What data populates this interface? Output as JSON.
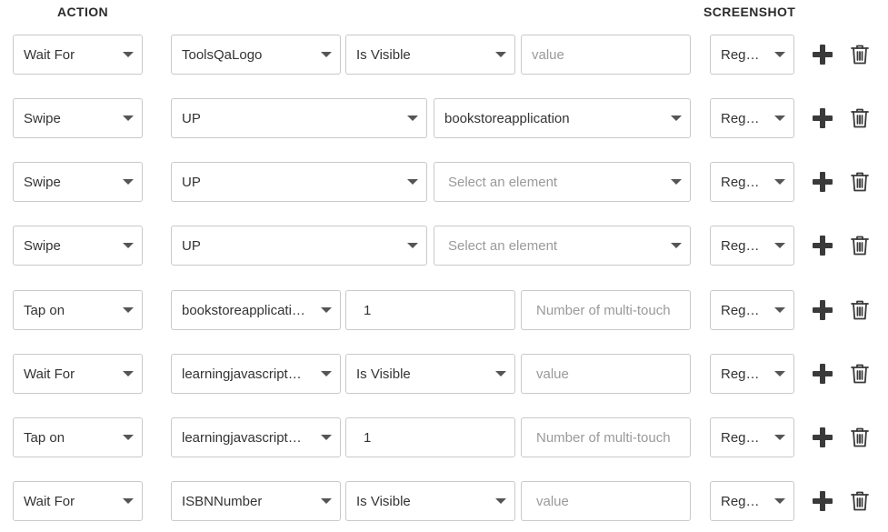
{
  "headers": {
    "action": "ACTION",
    "screenshot": "SCREENSHOT"
  },
  "rows": [
    {
      "action": "Wait For",
      "fields": [
        "ToolsQaLogo",
        "Is Visible"
      ],
      "placeholder": "value",
      "screenshot": "Reg…"
    },
    {
      "action": "Swipe",
      "direction": "UP",
      "element": "bookstoreapplication",
      "screenshot": "Reg…"
    },
    {
      "action": "Swipe",
      "direction": "UP",
      "element_placeholder": "Select an element",
      "screenshot": "Reg…"
    },
    {
      "action": "Swipe",
      "direction": "UP",
      "element_placeholder": "Select an element",
      "screenshot": "Reg…"
    },
    {
      "action": "Tap on",
      "fields": [
        "bookstoreapplicati…",
        "1"
      ],
      "placeholder": "Number of multi-touch",
      "screenshot": "Reg…"
    },
    {
      "action": "Wait For",
      "fields": [
        "learningjavascript…",
        "Is Visible"
      ],
      "placeholder": "value",
      "screenshot": "Reg…"
    },
    {
      "action": "Tap on",
      "fields": [
        "learningjavascript…",
        "1"
      ],
      "placeholder": "Number of multi-touch",
      "screenshot": "Reg…"
    },
    {
      "action": "Wait For",
      "fields": [
        "ISBNNumber",
        "Is Visible"
      ],
      "placeholder": "value",
      "screenshot": "Reg…"
    }
  ],
  "icons": {
    "add": "plus-icon",
    "delete": "trash-icon"
  },
  "colors": {
    "border": "#c9c9c9",
    "icon": "#3a3a3a",
    "placeholder": "#9a9a9a"
  }
}
